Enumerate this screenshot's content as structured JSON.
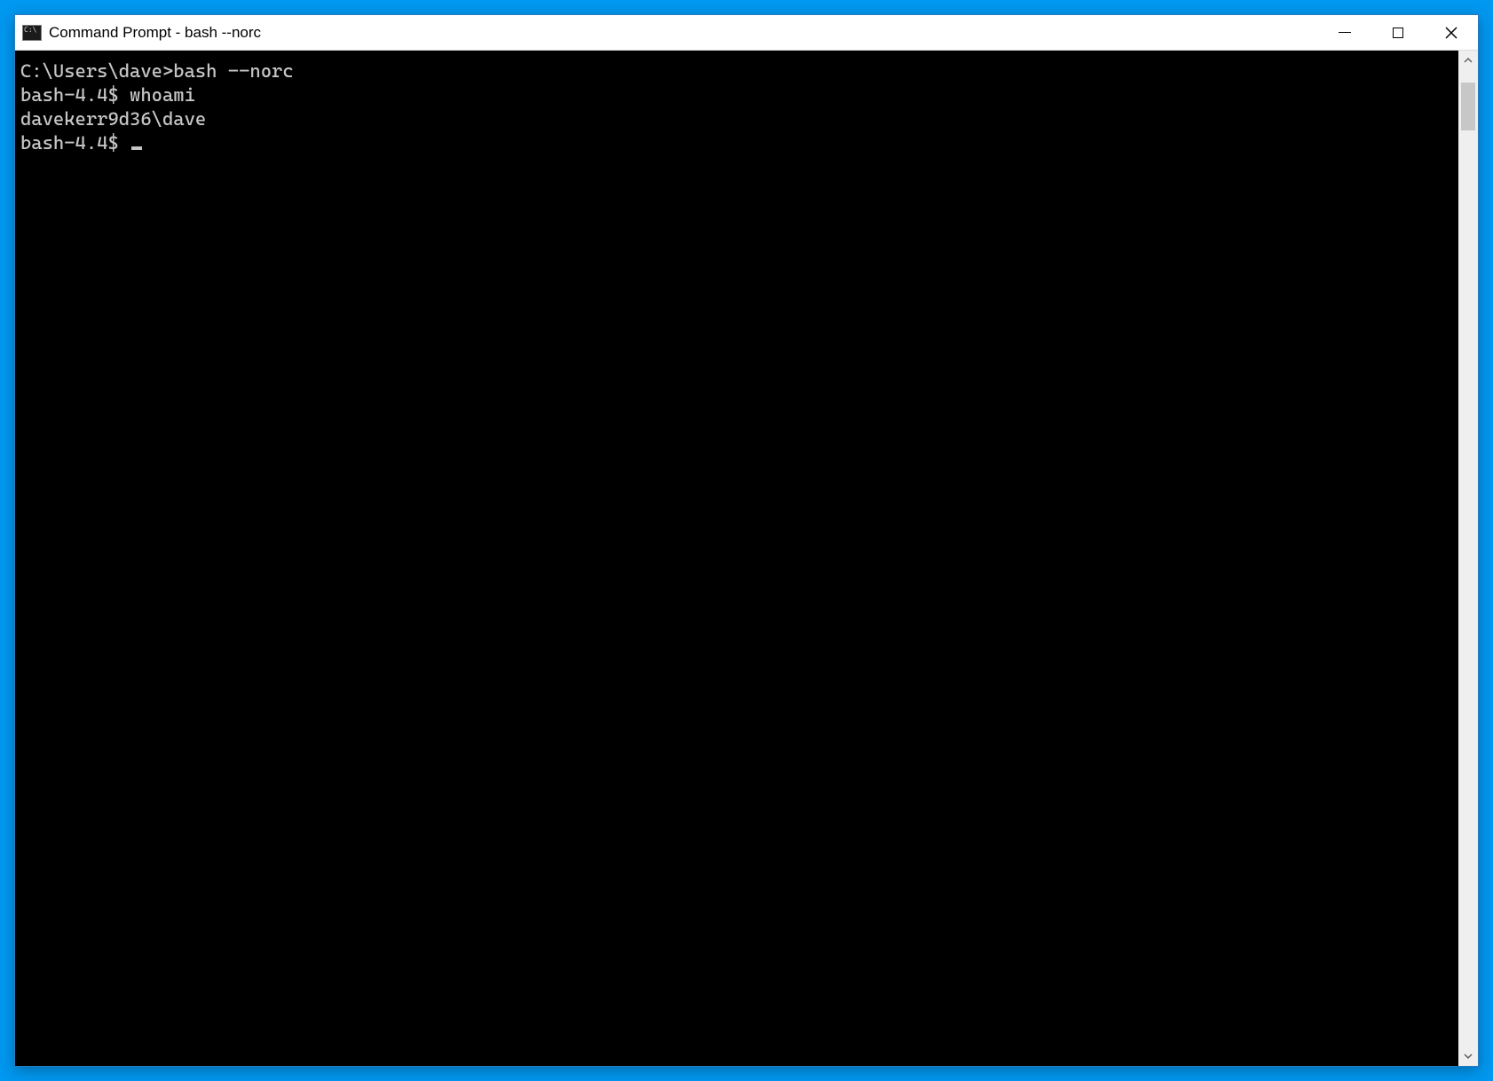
{
  "window": {
    "title": "Command Prompt - bash  --norc"
  },
  "terminal": {
    "lines": [
      "C:\\Users\\dave>bash --norc",
      "bash-4.4$ whoami",
      "davekerr9d36\\dave",
      "bash-4.4$ "
    ]
  }
}
